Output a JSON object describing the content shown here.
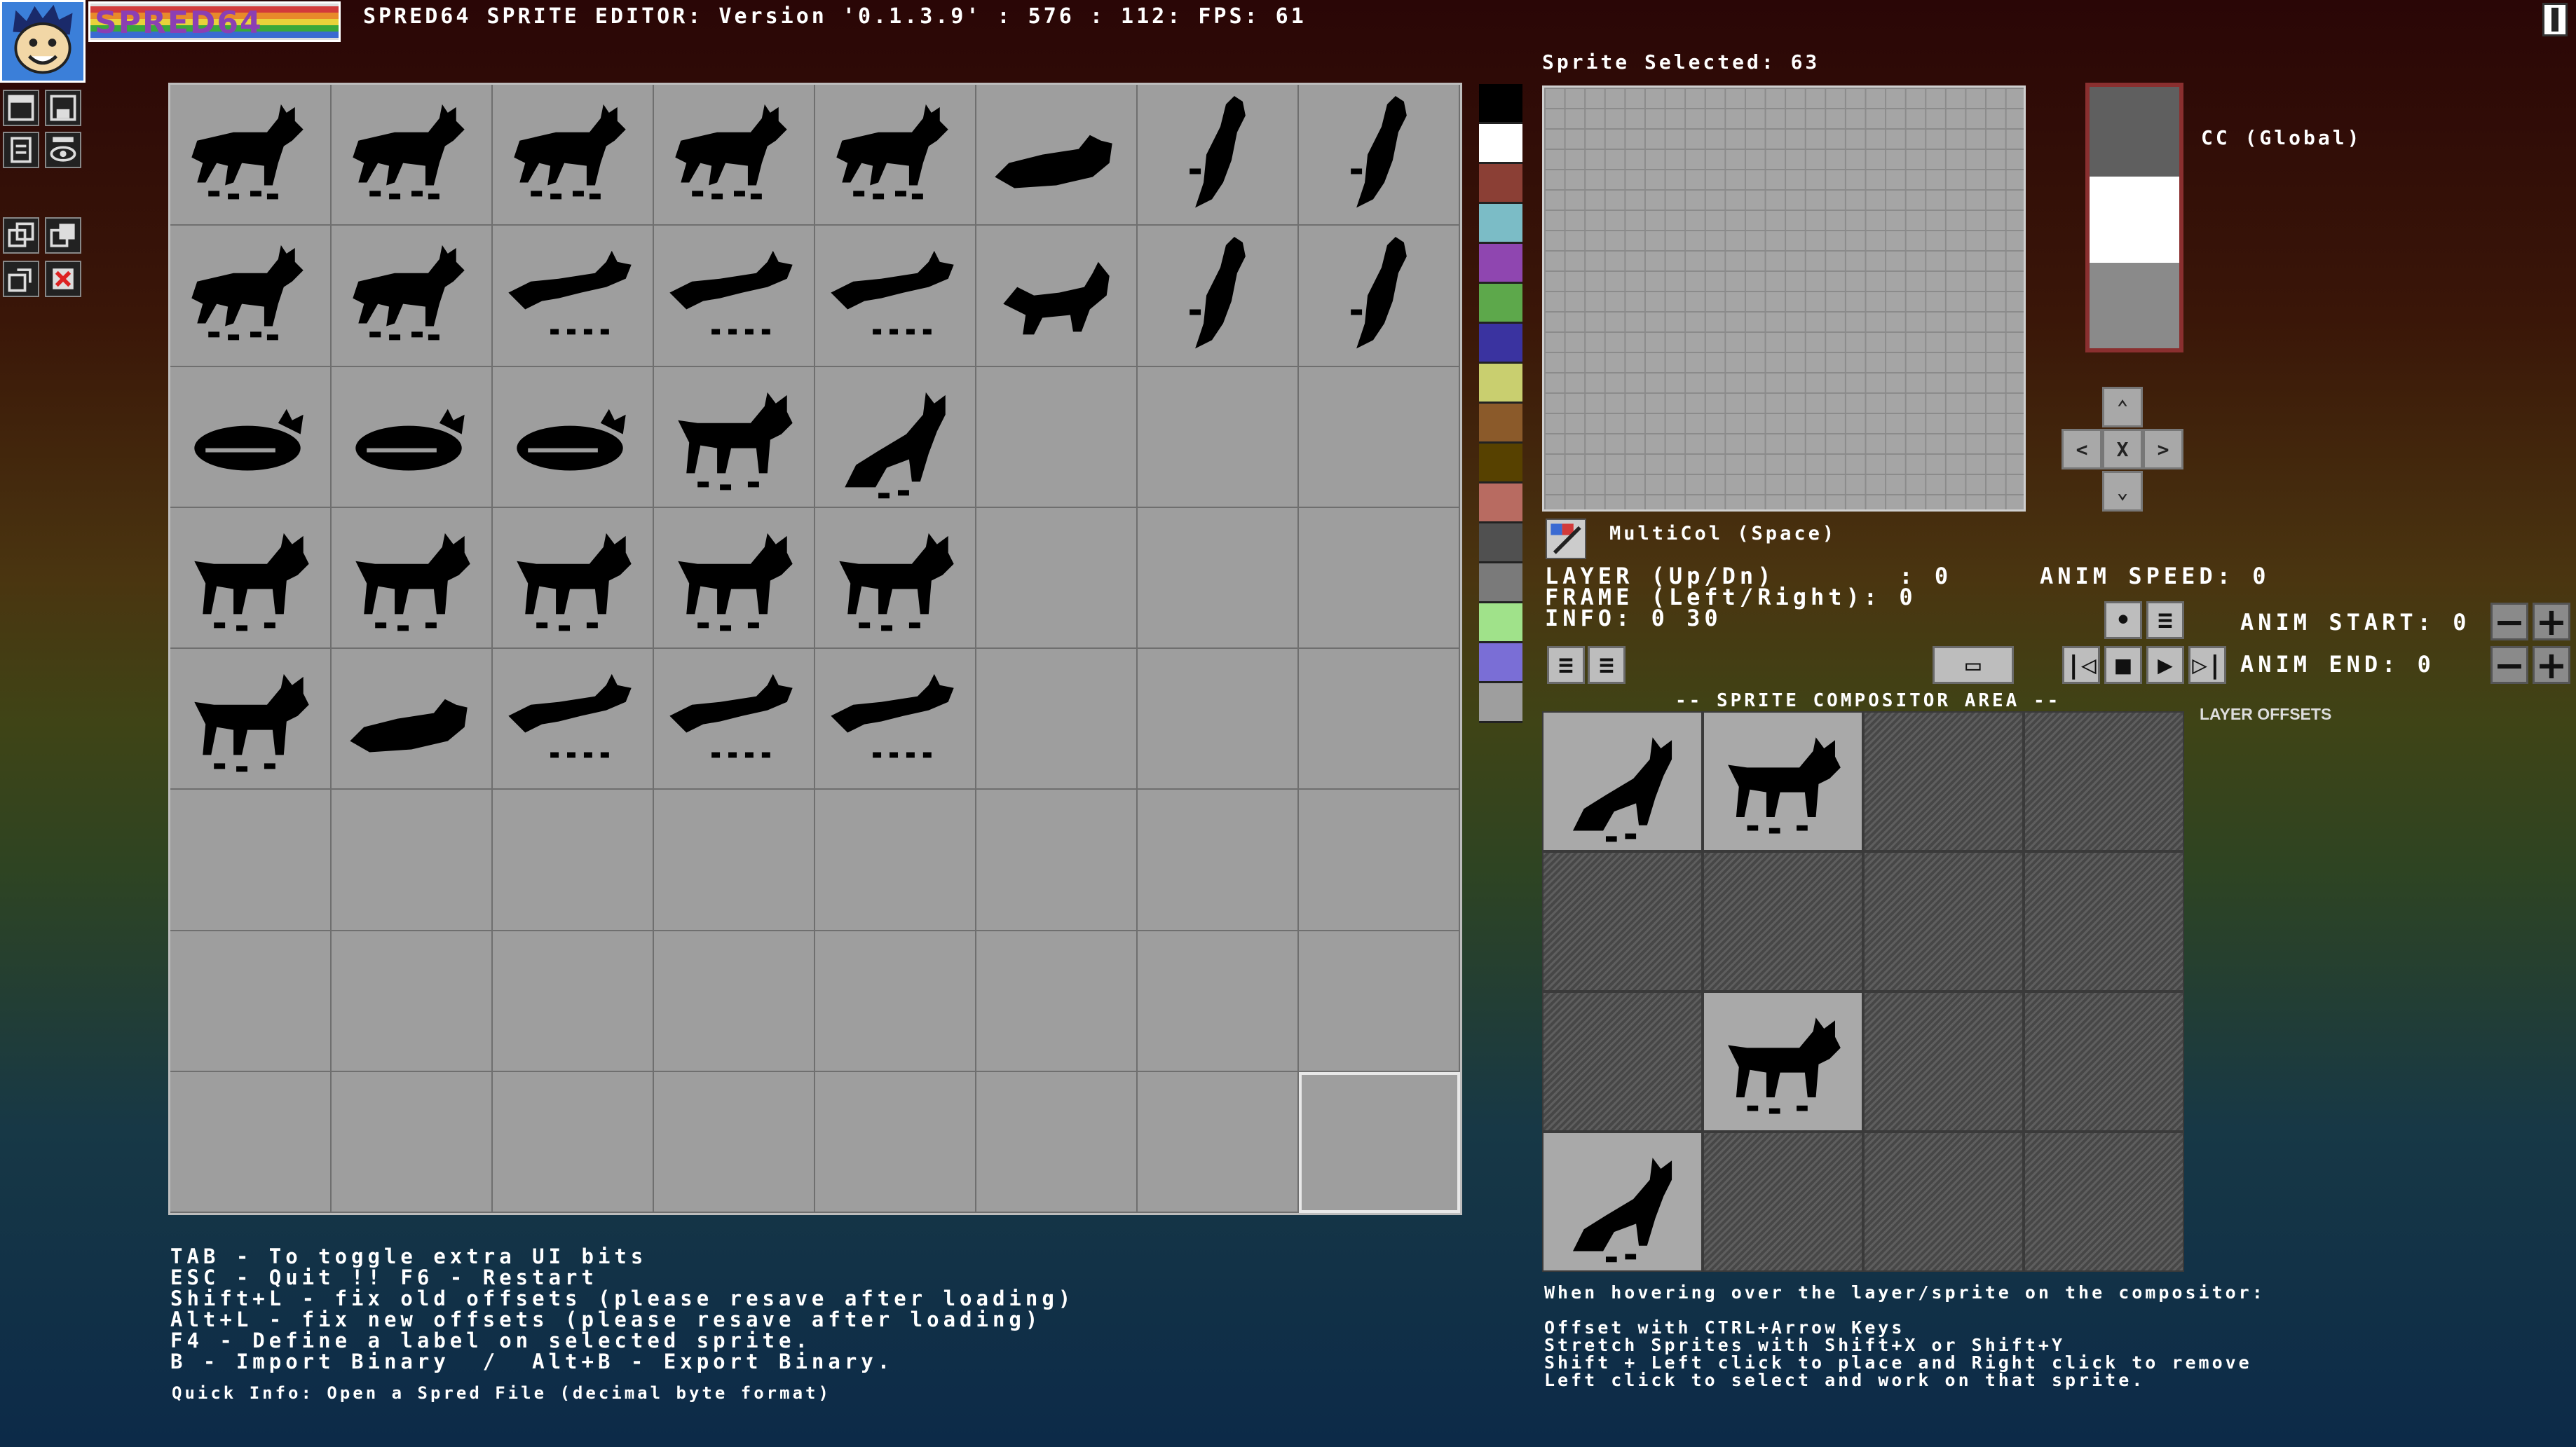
{
  "app": {
    "title": "SPRED64 SPRITE EDITOR: Version '0.1.3.9' : 576 : 112: FPS: 61",
    "logo_text": "SPRED64",
    "logo_stripes": [
      "#d23a3a",
      "#e88a2a",
      "#e8d23a",
      "#3aa83a",
      "#3a6ad2",
      "#8a3ad2"
    ]
  },
  "tools": [
    {
      "name": "new-file-icon"
    },
    {
      "name": "save-file-icon"
    },
    {
      "name": "open-file-icon"
    },
    {
      "name": "ui-info-eye-icon",
      "label": "UI INFO"
    },
    {
      "name": "copy-sprite-icon"
    },
    {
      "name": "paste-sprite-icon"
    },
    {
      "name": "duplicate-icon"
    },
    {
      "name": "clear-sprite-icon"
    }
  ],
  "sheet": {
    "rows": 8,
    "cols": 8,
    "selected_index": 63,
    "cat_pose_grid": [
      [
        "walk",
        "walk",
        "walk",
        "walk",
        "walk",
        "lie",
        "climb",
        "climb"
      ],
      [
        "walk",
        "walk",
        "run",
        "run",
        "run",
        "pounce",
        "climb",
        "climb"
      ],
      [
        "curl",
        "curl",
        "curl",
        "stand",
        "sit",
        "",
        "",
        ""
      ],
      [
        "stand",
        "stand",
        "stand",
        "stand",
        "stand",
        "",
        "",
        ""
      ],
      [
        "stand",
        "lie",
        "run",
        "run",
        "run",
        "",
        "",
        ""
      ],
      [
        "",
        "",
        "",
        "",
        "",
        "",
        "",
        ""
      ],
      [
        "",
        "",
        "",
        "",
        "",
        "",
        "",
        ""
      ],
      [
        "",
        "",
        "",
        "",
        "",
        "",
        "",
        ""
      ]
    ]
  },
  "palette": [
    "#000000",
    "#ffffff",
    "#8b3f35",
    "#7bbcc6",
    "#8f46b0",
    "#5da84b",
    "#3a33a0",
    "#c9cf6f",
    "#8b5a2a",
    "#574100",
    "#b86b61",
    "#505050",
    "#7a7a7a",
    "#a0e28a",
    "#7a6ed6",
    "#9e9e9e"
  ],
  "editor": {
    "sprite_selected_label": "Sprite Selected: 63",
    "cc_label": "CC (Global)",
    "cc_colors": [
      "#5f5f5f",
      "#ffffff",
      "#8a8a8a"
    ],
    "multicol_label": "MultiCol (Space)",
    "layer_line": "LAYER (Up/Dn)       : 0",
    "frame_line": "FRAME (Left/Right): 0",
    "info_line": "INFO: 0 30",
    "anim_speed": "ANIM SPEED: 0",
    "anim_start": "ANIM START: 0",
    "anim_end": "ANIM END: 0",
    "dpad": {
      "up": "⌃",
      "left": "<",
      "center": "X",
      "right": ">",
      "down": "⌄"
    }
  },
  "compositor": {
    "title": "-- SPRITE COMPOSITOR AREA --",
    "layer_offsets": "LAYER OFFSETS",
    "cells": [
      "cat-sit",
      "cat-stand",
      "",
      "",
      "",
      "",
      "",
      "",
      "",
      "cat-stand",
      "",
      "",
      "cat-sit",
      "",
      "",
      ""
    ]
  },
  "help_left": [
    "TAB - To toggle extra UI bits",
    "ESC - Quit !! F6 - Restart",
    "Shift+L - fix old offsets (please resave after loading)",
    "Alt+L - fix new offsets (please resave after loading)",
    "F4 - Define a label on selected sprite.",
    "B - Import Binary  /  Alt+B - Export Binary."
  ],
  "quick_info": "Quick Info: Open a Spred File (decimal byte format)",
  "help_right": {
    "hover": "When hovering over the layer/sprite on the compositor:",
    "lines": [
      "Offset with CTRL+Arrow Keys",
      "Stretch Sprites with Shift+X or Shift+Y",
      "Shift + Left click to place and Right click to remove",
      "Left click to select and work on that sprite."
    ]
  }
}
